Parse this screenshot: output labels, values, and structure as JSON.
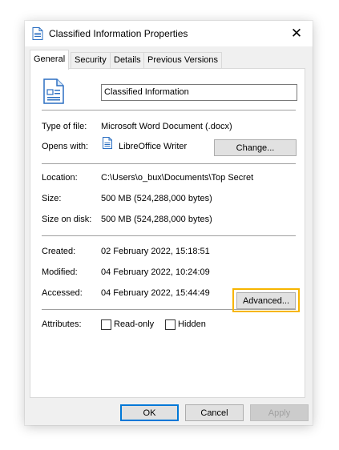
{
  "window": {
    "title": "Classified Information Properties",
    "close_glyph": "✕"
  },
  "tabs": [
    {
      "label": "General",
      "active": true
    },
    {
      "label": "Security",
      "active": false
    },
    {
      "label": "Details",
      "active": false
    },
    {
      "label": "Previous Versions",
      "active": false
    }
  ],
  "general": {
    "file_name": "Classified Information",
    "type_label": "Type of file:",
    "type_value": "Microsoft Word Document (.docx)",
    "opens_label": "Opens with:",
    "opens_value": "LibreOffice Writer",
    "change_label": "Change...",
    "location_label": "Location:",
    "location_value": "C:\\Users\\o_bux\\Documents\\Top Secret",
    "size_label": "Size:",
    "size_value": "500 MB (524,288,000 bytes)",
    "size_on_disk_label": "Size on disk:",
    "size_on_disk_value": "500 MB (524,288,000 bytes)",
    "created_label": "Created:",
    "created_value": "02 February 2022, 15:18:51",
    "modified_label": "Modified:",
    "modified_value": "04 February 2022, 10:24:09",
    "accessed_label": "Accessed:",
    "accessed_value": "04 February 2022, 15:44:49",
    "attributes_label": "Attributes:",
    "readonly_label": "Read-only",
    "readonly_checked": false,
    "hidden_label": "Hidden",
    "hidden_checked": false,
    "advanced_label": "Advanced..."
  },
  "footer": {
    "ok_label": "OK",
    "cancel_label": "Cancel",
    "apply_label": "Apply"
  },
  "colors": {
    "highlight": "#f7b500",
    "doc_icon_blue": "#2b6fc2",
    "dialog_bg": "#f0f0f0"
  },
  "icons": {
    "title": "document-icon",
    "file": "writer-document-icon",
    "app": "libreoffice-writer-icon"
  }
}
